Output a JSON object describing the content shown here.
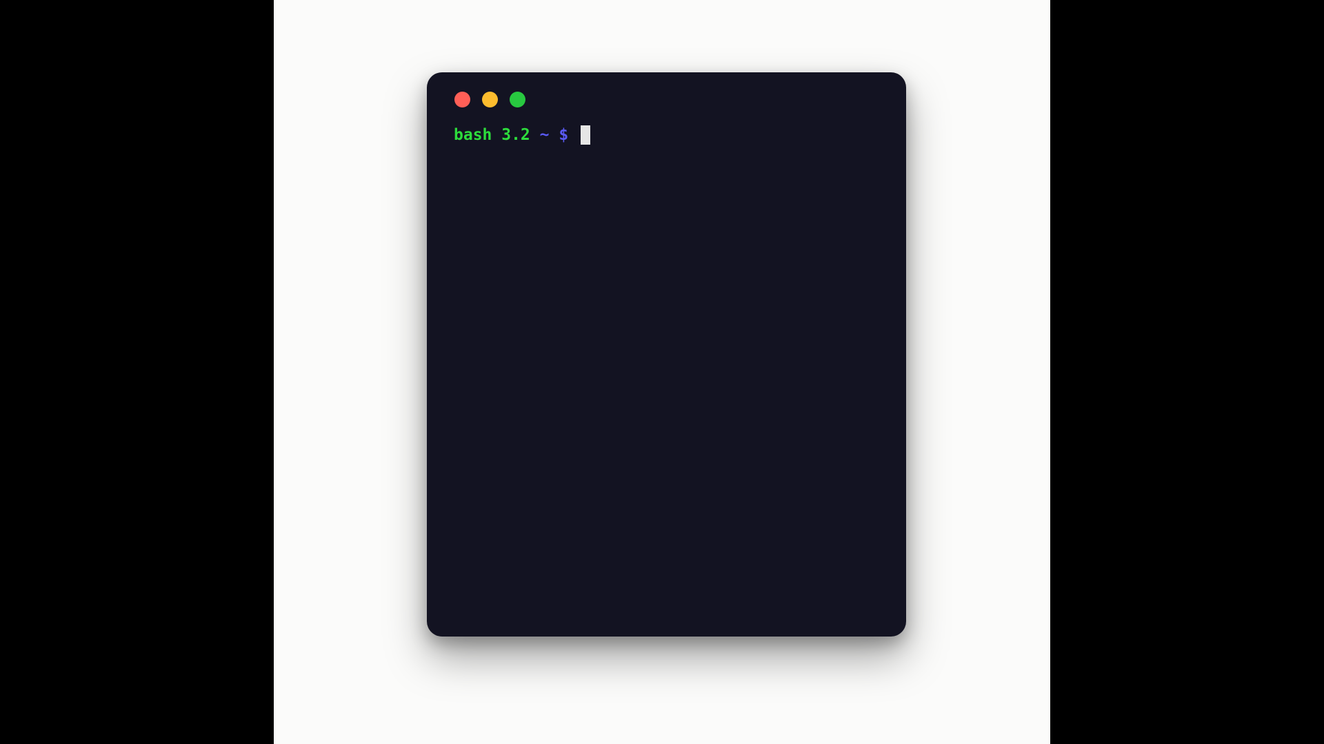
{
  "window": {
    "buttons": [
      {
        "name": "close",
        "color": "#ff5f57"
      },
      {
        "name": "minimize",
        "color": "#fdbc2e"
      },
      {
        "name": "zoom",
        "color": "#28c840"
      }
    ],
    "background_color": "#131322"
  },
  "terminal": {
    "prompt_shell": "bash 3.2",
    "prompt_path": "~",
    "prompt_symbol": "$",
    "input_text": "",
    "shell_color": "#2ddc3c",
    "path_color": "#5a5af5",
    "symbol_color": "#5a5af5",
    "cursor_color": "#e6e6e6"
  },
  "page": {
    "canvas_color": "#fbfbfa",
    "letterbox_color": "#000000"
  }
}
